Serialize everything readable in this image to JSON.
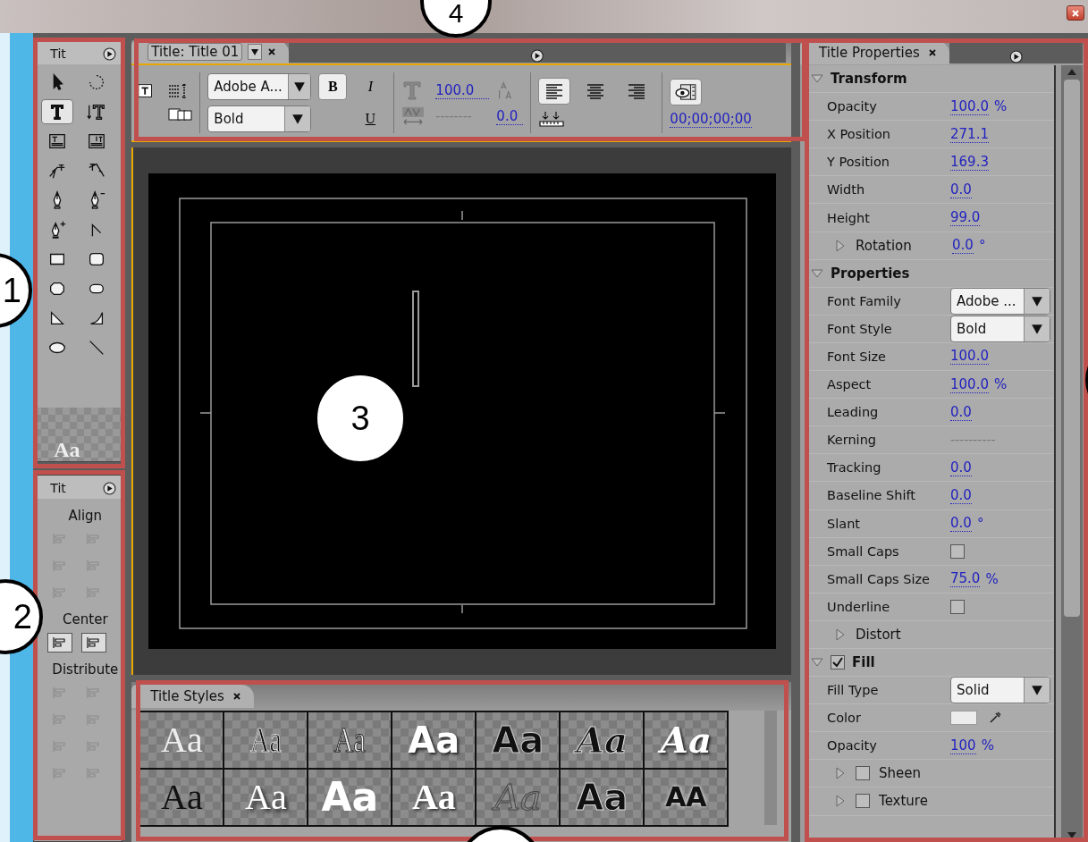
{
  "tools_panel": {
    "title": "Tit",
    "tools": [
      {
        "kind": "arrow",
        "selected": false
      },
      {
        "kind": "rotate",
        "selected": false
      },
      {
        "kind": "type",
        "selected": true
      },
      {
        "kind": "vtype",
        "selected": false
      },
      {
        "kind": "area",
        "selected": false
      },
      {
        "kind": "varea",
        "selected": false
      },
      {
        "kind": "path",
        "selected": false
      },
      {
        "kind": "vpath",
        "selected": false
      },
      {
        "kind": "pen",
        "selected": false
      },
      {
        "kind": "penminus",
        "selected": false
      },
      {
        "kind": "penplus",
        "selected": false
      },
      {
        "kind": "anchor",
        "selected": false
      },
      {
        "kind": "rect",
        "selected": false
      },
      {
        "kind": "rrect",
        "selected": false
      },
      {
        "kind": "crect",
        "selected": false
      },
      {
        "kind": "pill",
        "selected": false
      },
      {
        "kind": "wedge",
        "selected": false
      },
      {
        "kind": "arc",
        "selected": false
      },
      {
        "kind": "ellipse",
        "selected": false
      },
      {
        "kind": "line",
        "selected": false
      }
    ],
    "preview": "Aa"
  },
  "align_panel": {
    "title": "Tit",
    "sections": [
      {
        "label": "Align",
        "buttons": [
          {
            "disabled": true
          },
          {
            "disabled": true
          },
          {
            "disabled": true
          },
          {
            "disabled": true
          },
          {
            "disabled": true
          },
          {
            "disabled": true
          }
        ]
      },
      {
        "label": "Center",
        "buttons": [
          {
            "disabled": false
          },
          {
            "disabled": false
          }
        ]
      },
      {
        "label": "Distribute",
        "buttons": [
          {
            "disabled": true
          },
          {
            "disabled": true
          },
          {
            "disabled": true
          },
          {
            "disabled": true
          },
          {
            "disabled": true
          },
          {
            "disabled": true
          },
          {
            "disabled": true
          },
          {
            "disabled": true
          }
        ]
      }
    ]
  },
  "title_panel": {
    "tab": "Title: Title 01",
    "font_family": "Adobe A...",
    "font_style": "Bold",
    "bold": {
      "label": "B",
      "selected": true
    },
    "italic": {
      "label": "I",
      "selected": false
    },
    "underline": {
      "label": "U",
      "selected": false
    },
    "font_size": "100.0",
    "kerning": "--------",
    "tracking": "0.0",
    "align": [
      {
        "selected": true
      },
      {
        "selected": false
      },
      {
        "selected": false
      }
    ],
    "timecode": "00;00;00;00"
  },
  "styles_panel": {
    "title": "Title Styles",
    "swatches": [
      {
        "text": "Aa",
        "kind": "serif-white"
      },
      {
        "text": "Aa",
        "kind": "narrow-black"
      },
      {
        "text": "Aa",
        "kind": "narrow-white"
      },
      {
        "text": "Aa",
        "kind": "heavy-white"
      },
      {
        "text": "Aa",
        "kind": "heavy-black"
      },
      {
        "text": "Aa",
        "kind": "script-black"
      },
      {
        "text": "Aa",
        "kind": "script-white"
      },
      {
        "text": "Aa",
        "kind": "serif-black"
      },
      {
        "text": "Aa",
        "kind": "serif-shadow"
      },
      {
        "text": "Aa",
        "kind": "block-white"
      },
      {
        "text": "Aa",
        "kind": "sans-white"
      },
      {
        "text": "Aa",
        "kind": "outline"
      },
      {
        "text": "Aa",
        "kind": "round-black"
      },
      {
        "text": "AA",
        "kind": "caps-black"
      }
    ]
  },
  "properties_panel": {
    "title": "Title Properties",
    "rows": [
      {
        "kind": "section",
        "label": "Transform",
        "expanded": true
      },
      {
        "kind": "value",
        "label": "Opacity",
        "value": "100.0",
        "unit": "%"
      },
      {
        "kind": "value",
        "label": "X Position",
        "value": "271.1"
      },
      {
        "kind": "value",
        "label": "Y Position",
        "value": "169.3"
      },
      {
        "kind": "value",
        "label": "Width",
        "value": "0.0"
      },
      {
        "kind": "value",
        "label": "Height",
        "value": "99.0"
      },
      {
        "kind": "group",
        "label": "Rotation",
        "expanded": false,
        "value": "0.0",
        "unit": "°"
      },
      {
        "kind": "section",
        "label": "Properties",
        "expanded": true
      },
      {
        "kind": "dropdown",
        "label": "Font Family",
        "value": "Adobe ..."
      },
      {
        "kind": "dropdown",
        "label": "Font Style",
        "value": "Bold"
      },
      {
        "kind": "value",
        "label": "Font Size",
        "value": "100.0"
      },
      {
        "kind": "value",
        "label": "Aspect",
        "value": "100.0",
        "unit": "%"
      },
      {
        "kind": "value",
        "label": "Leading",
        "value": "0.0"
      },
      {
        "kind": "value",
        "label": "Kerning",
        "value": "----------",
        "disabled": true
      },
      {
        "kind": "value",
        "label": "Tracking",
        "value": "0.0"
      },
      {
        "kind": "value",
        "label": "Baseline Shift",
        "value": "0.0"
      },
      {
        "kind": "value",
        "label": "Slant",
        "value": "0.0",
        "unit": "°"
      },
      {
        "kind": "checkbox",
        "label": "Small Caps",
        "checked": false
      },
      {
        "kind": "value",
        "label": "Small Caps Size",
        "value": "75.0",
        "unit": "%"
      },
      {
        "kind": "checkbox",
        "label": "Underline",
        "checked": false
      },
      {
        "kind": "group",
        "label": "Distort",
        "expanded": false
      },
      {
        "kind": "section",
        "label": "Fill",
        "expanded": true,
        "checked": true
      },
      {
        "kind": "dropdown",
        "label": "Fill Type",
        "value": "Solid"
      },
      {
        "kind": "color",
        "label": "Color",
        "color": "#ececec"
      },
      {
        "kind": "value",
        "label": "Opacity",
        "value": "100",
        "unit": "%"
      },
      {
        "kind": "group",
        "label": "Sheen",
        "expanded": false,
        "checked": false
      },
      {
        "kind": "group",
        "label": "Texture",
        "expanded": false,
        "checked": false
      }
    ]
  },
  "callouts": [
    {
      "kind": "numbered",
      "number": "1"
    },
    {
      "kind": "numbered",
      "number": "2"
    },
    {
      "kind": "numbered",
      "number": "3"
    },
    {
      "kind": "numbered",
      "number": "4"
    },
    {
      "kind": "plain"
    },
    {
      "kind": "plain"
    }
  ]
}
